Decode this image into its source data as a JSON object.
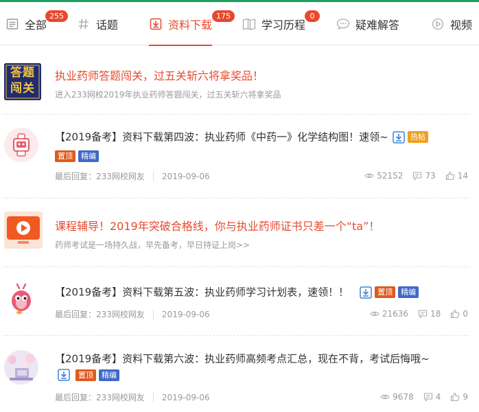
{
  "tabs": [
    {
      "label": "全部",
      "icon": "list-icon",
      "badge": "255"
    },
    {
      "label": "话题",
      "icon": "hash-icon",
      "badge": ""
    },
    {
      "label": "资料下载",
      "icon": "download-icon",
      "badge": "175",
      "active": true
    },
    {
      "label": "学习历程",
      "icon": "book-icon",
      "badge": "0"
    },
    {
      "label": "疑难解答",
      "icon": "chat-icon",
      "badge": ""
    },
    {
      "label": "视频",
      "icon": "play-icon",
      "badge": ""
    }
  ],
  "colors": {
    "accent": "#e8492e",
    "brand_green": "#1e9e5e",
    "tag_hot": "#f0a01e",
    "tag_top": "#e05a1d",
    "tag_essence": "#3f68c9"
  },
  "promos": [
    {
      "thumb_text": "答题闯关",
      "title": "执业药师答题闯关，过五关斩六将拿奖品！",
      "desc": "进入233网校2019年执业药师答题闯关，过五关斩六将拿奖品"
    },
    {
      "title": "课程辅导！2019年突破合格线，你与执业药师证书只差一个“ta”！",
      "desc": "药师考试是一场持久战，早先备考，早日持证上岗>>"
    }
  ],
  "posts": [
    {
      "title": "【2019备考】资料下载第四波：执业药师《中药一》化学结构图！速领~",
      "tags": [
        "热帖",
        "置顶",
        "精编"
      ],
      "last_reply_label": "最后回复：",
      "last_reply_user": "233网校网友",
      "date": "2019-09-06",
      "views": "52152",
      "comments": "73",
      "likes": "14"
    },
    {
      "title": "【2019备考】资料下载第五波：执业药师学习计划表，速领！！",
      "tags": [
        "置顶",
        "精编"
      ],
      "last_reply_label": "最后回复：",
      "last_reply_user": "233网校网友",
      "date": "2019-09-06",
      "views": "21636",
      "comments": "18",
      "likes": "0"
    },
    {
      "title": "【2019备考】资料下载第六波：执业药师高频考点汇总，现在不背，考试后悔哦~",
      "tags": [
        "置顶",
        "精编"
      ],
      "last_reply_label": "最后回复：",
      "last_reply_user": "233网校网友",
      "date": "2019-09-06",
      "views": "9678",
      "comments": "4",
      "likes": "9"
    }
  ]
}
